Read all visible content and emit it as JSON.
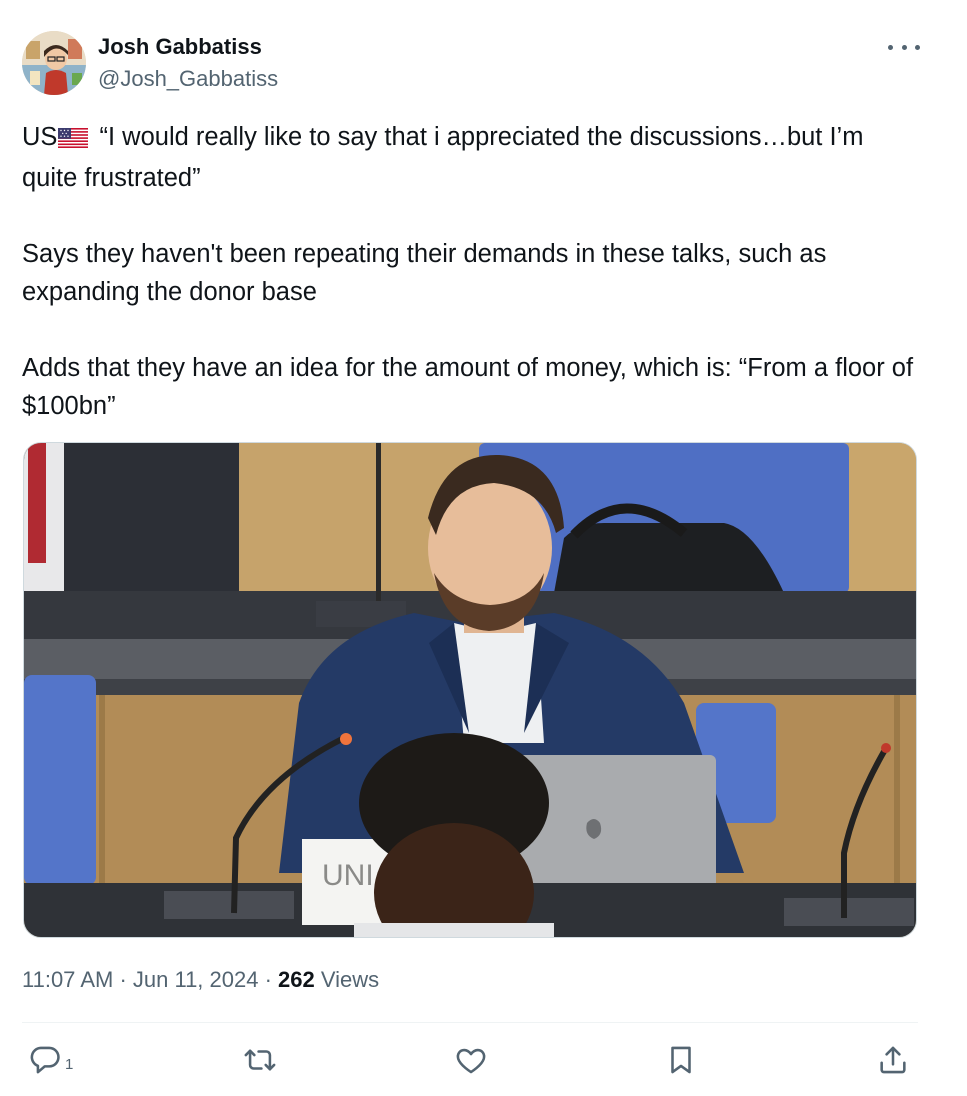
{
  "author": {
    "name": "Josh Gabbatiss",
    "handle": "@Josh_Gabbatiss"
  },
  "tweet": {
    "line1_prefix": "US",
    "line1_rest": " “I would really like to say that i appreciated the discussions…but I’m quite frustrated”",
    "para2": "Says they haven't been repeating their demands in these talks, such as expanding the donor base",
    "para3": "Adds that they have an idea for the amount of money, which is: “From a floor of $100bn”",
    "media_placard": "UNI"
  },
  "meta": {
    "time": "11:07 AM",
    "sep1": " · ",
    "date": "Jun 11, 2024",
    "sep2": " · ",
    "views_count": "262",
    "views_label": " Views"
  },
  "actions": {
    "reply_count": "1"
  },
  "icons": [
    "more-icon",
    "us-flag-icon",
    "reply-icon",
    "retweet-icon",
    "like-icon",
    "bookmark-icon",
    "share-icon"
  ],
  "colors": {
    "text": "#0f1419",
    "secondary": "#536471",
    "divider": "#eff3f4"
  }
}
